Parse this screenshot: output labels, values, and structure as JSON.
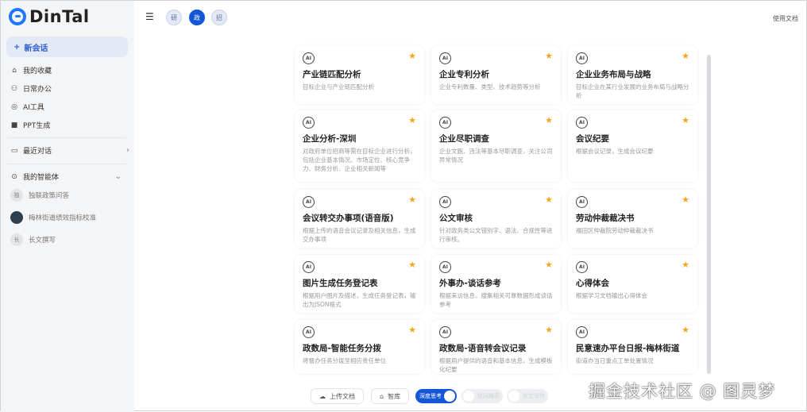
{
  "app": {
    "logo": "DinTal",
    "docs_link": "使用文档"
  },
  "sidebar": {
    "new_chat": "新会话",
    "items": [
      {
        "icon": "home-icon",
        "label": "我的收藏"
      },
      {
        "icon": "office-icon",
        "label": "日常办公"
      },
      {
        "icon": "ai-tool-icon",
        "label": "AI工具"
      },
      {
        "icon": "ppt-icon",
        "label": "PPT生成"
      }
    ],
    "recent": "最近对话",
    "agents_header": "我的智能体",
    "agents": [
      {
        "avatar": "独",
        "label": "独联政策问答"
      },
      {
        "avatar": "",
        "label": "梅林街道绩效指标校准"
      },
      {
        "avatar": "长",
        "label": "长文撰写"
      }
    ]
  },
  "header": {
    "pills": [
      "研",
      "政",
      "招"
    ]
  },
  "cards": [
    {
      "title": "产业链匹配分析",
      "desc": "目标企业与产业链匹配分析"
    },
    {
      "title": "企业专利分析",
      "desc": "企业专利数量、类型、技术趋势等分析"
    },
    {
      "title": "企业业务布局与战略",
      "desc": "目标企业在某行业发展的业务布局与战略分析"
    },
    {
      "title": "企业分析-深圳",
      "desc": "对政府单位招商等需在目标企业进行分析，包括企业基本情况、市场定位、核心竞争力、财务分析、企业相关新闻等"
    },
    {
      "title": "企业尽职调查",
      "desc": "企业文跑、违法等基本尽职调查，关注公司异常情况"
    },
    {
      "title": "会议纪要",
      "desc": "根据会议记录，生成会议纪要"
    },
    {
      "title": "会议转交办事项(语音版)",
      "desc": "根据上传的语音会议记录及相关信息，生成交办事项"
    },
    {
      "title": "公文审核",
      "desc": "针对政务类公文错别字、语法、合规性等进行审核。"
    },
    {
      "title": "劳动仲裁裁决书",
      "desc": "福田区仲裁院劳动仲裁裁决书"
    },
    {
      "title": "图片生成任务登记表",
      "desc": "根据用户图片及描述，生成任务登记表，输出为JSON格式"
    },
    {
      "title": "外事办-谈话参考",
      "desc": "根据来访信息，搜集相关可靠数据形成谈话参考"
    },
    {
      "title": "心得体会",
      "desc": "根据学习文档输出心得体会"
    },
    {
      "title": "政数局-智能任务分拨",
      "desc": "将督办任务分拨至相应责任单位"
    },
    {
      "title": "政数局-语音转会议记录",
      "desc": "根据用户提供的语音和基本信息，生成模板化纪要"
    },
    {
      "title": "民意速办平台日报-梅林街道",
      "desc": "街道办当日重点工单处置情况"
    }
  ],
  "toolbar": {
    "upload": "上传文档",
    "kb": "智库",
    "toggles": [
      {
        "label": "深度思考",
        "on": true
      },
      {
        "label": "联网搜索",
        "on": false
      },
      {
        "label": "长文写作",
        "on": false
      }
    ]
  },
  "watermark": "掘金技术社区 @ 图灵梦"
}
